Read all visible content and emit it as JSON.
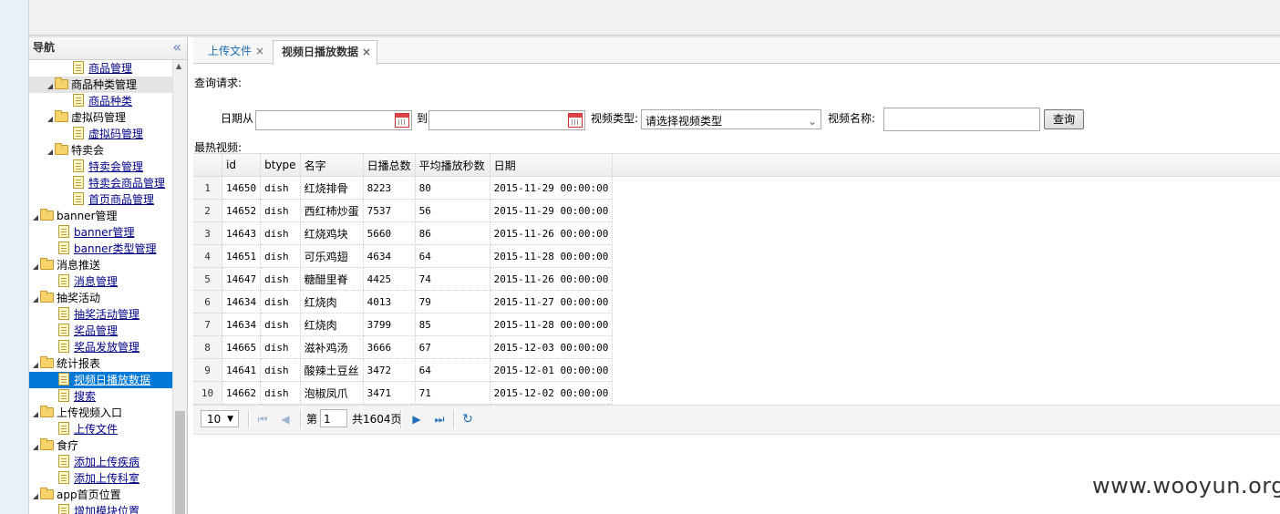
{
  "nav": {
    "title": "导航",
    "items": [
      {
        "indent": 48,
        "type": "file",
        "label": "商品管理",
        "link": true
      },
      {
        "indent": 18,
        "type": "folder",
        "label": "商品种类管理",
        "toggle": "◢",
        "hl": true
      },
      {
        "indent": 48,
        "type": "file",
        "label": "商品种类",
        "link": true
      },
      {
        "indent": 18,
        "type": "folder",
        "label": "虚拟码管理",
        "toggle": "◢"
      },
      {
        "indent": 48,
        "type": "file",
        "label": "虚拟码管理",
        "link": true
      },
      {
        "indent": 18,
        "type": "folder",
        "label": "特卖会",
        "toggle": "◢"
      },
      {
        "indent": 48,
        "type": "file",
        "label": "特卖会管理",
        "link": true
      },
      {
        "indent": 48,
        "type": "file",
        "label": "特卖会商品管理",
        "link": true
      },
      {
        "indent": 48,
        "type": "file",
        "label": "首页商品管理",
        "link": true
      },
      {
        "indent": 2,
        "type": "folder",
        "label": "banner管理",
        "toggle": "◢"
      },
      {
        "indent": 32,
        "type": "file",
        "label": "banner管理",
        "link": true
      },
      {
        "indent": 32,
        "type": "file",
        "label": "banner类型管理",
        "link": true
      },
      {
        "indent": 2,
        "type": "folder",
        "label": "消息推送",
        "toggle": "◢"
      },
      {
        "indent": 32,
        "type": "file",
        "label": "消息管理",
        "link": true
      },
      {
        "indent": 2,
        "type": "folder",
        "label": "抽奖活动",
        "toggle": "◢"
      },
      {
        "indent": 32,
        "type": "file",
        "label": "抽奖活动管理",
        "link": true
      },
      {
        "indent": 32,
        "type": "file",
        "label": "奖品管理",
        "link": true
      },
      {
        "indent": 32,
        "type": "file",
        "label": "奖品发放管理",
        "link": true
      },
      {
        "indent": 2,
        "type": "folder",
        "label": "统计报表",
        "toggle": "◢"
      },
      {
        "indent": 32,
        "type": "file",
        "label": "视频日播放数据",
        "link": true,
        "sel": true
      },
      {
        "indent": 32,
        "type": "file",
        "label": "搜索",
        "link": true
      },
      {
        "indent": 2,
        "type": "folder",
        "label": "上传视频入口",
        "toggle": "◢"
      },
      {
        "indent": 32,
        "type": "file",
        "label": "上传文件",
        "link": true
      },
      {
        "indent": 2,
        "type": "folder",
        "label": "食疗",
        "toggle": "◢"
      },
      {
        "indent": 32,
        "type": "file",
        "label": "添加上传疾病",
        "link": true
      },
      {
        "indent": 32,
        "type": "file",
        "label": "添加上传科室",
        "link": true
      },
      {
        "indent": 2,
        "type": "folder",
        "label": "app首页位置",
        "toggle": "◢"
      },
      {
        "indent": 32,
        "type": "file",
        "label": "增加模块位置",
        "link": true
      }
    ]
  },
  "tabs": [
    {
      "label": "上传文件",
      "close": "×"
    },
    {
      "label": "视频日播放数据",
      "close": "×"
    }
  ],
  "query": {
    "title": "查询请求:",
    "date_from_label": "日期从",
    "date_to_label": "到",
    "video_type_label": "视频类型:",
    "video_type_value": "请选择视频类型",
    "video_name_label": "视频名称:",
    "search_button": "查询"
  },
  "hot_label": "最热视频:",
  "table": {
    "headers": [
      "id",
      "btype",
      "名字",
      "日播总数",
      "平均播放秒数",
      "日期"
    ],
    "rows": [
      [
        "1",
        "14650",
        "dish",
        "红烧排骨",
        "8223",
        "80",
        "2015-11-29 00:00:00"
      ],
      [
        "2",
        "14652",
        "dish",
        "西红柿炒蛋",
        "7537",
        "56",
        "2015-11-29 00:00:00"
      ],
      [
        "3",
        "14643",
        "dish",
        "红烧鸡块",
        "5660",
        "86",
        "2015-11-26 00:00:00"
      ],
      [
        "4",
        "14651",
        "dish",
        "可乐鸡翅",
        "4634",
        "64",
        "2015-11-28 00:00:00"
      ],
      [
        "5",
        "14647",
        "dish",
        "糖醋里脊",
        "4425",
        "74",
        "2015-11-26 00:00:00"
      ],
      [
        "6",
        "14634",
        "dish",
        "红烧肉",
        "4013",
        "79",
        "2015-11-27 00:00:00"
      ],
      [
        "7",
        "14634",
        "dish",
        "红烧肉",
        "3799",
        "85",
        "2015-11-28 00:00:00"
      ],
      [
        "8",
        "14665",
        "dish",
        "滋补鸡汤",
        "3666",
        "67",
        "2015-12-03 00:00:00"
      ],
      [
        "9",
        "14641",
        "dish",
        "酸辣土豆丝",
        "3472",
        "64",
        "2015-12-01 00:00:00"
      ],
      [
        "10",
        "14662",
        "dish",
        "泡椒凤爪",
        "3471",
        "71",
        "2015-12-02 00:00:00"
      ]
    ]
  },
  "pager": {
    "page_size": "10",
    "page_prefix": "第",
    "page_value": "1",
    "total_text": "共1604页"
  },
  "watermark": "www.wooyun.org",
  "colors": {
    "selected": "#0078d7",
    "link": "#000088",
    "tab_link": "#1a6cb0"
  }
}
